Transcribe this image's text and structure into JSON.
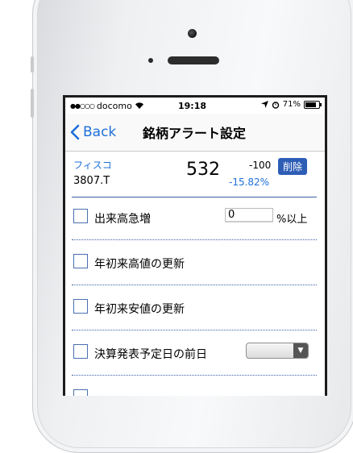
{
  "status_bar": {
    "signal": "●●○○○",
    "carrier": "docomo",
    "time": "19:18",
    "battery": "71%"
  },
  "nav": {
    "back_label": "Back",
    "title": "銘柄アラート設定"
  },
  "stock": {
    "name": "フィスコ",
    "code": "3807.T",
    "price": "532",
    "change": "-100",
    "change_pct": "-15.82%",
    "delete_label": "削除"
  },
  "alerts": [
    {
      "label": "出来高急増",
      "input_value": "0",
      "unit": "%以上"
    },
    {
      "label": "年初来高値の更新"
    },
    {
      "label": "年初来安値の更新"
    },
    {
      "label": "決算発表予定日の前日"
    }
  ],
  "colors": {
    "accent": "#1e6fd9",
    "delete_button": "#2e5db6",
    "divider": "#3a5fa8"
  }
}
